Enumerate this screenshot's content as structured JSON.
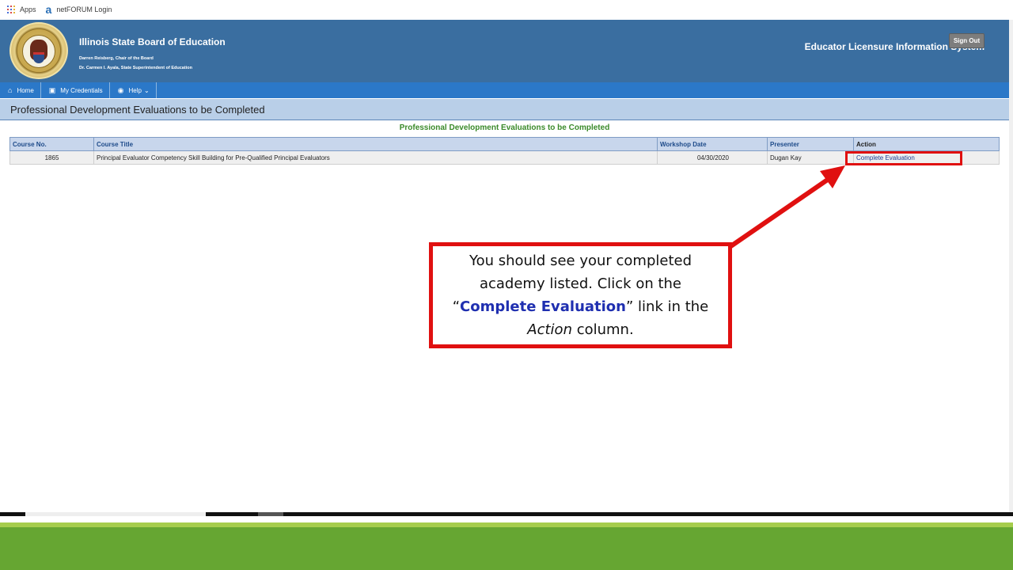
{
  "bookmarks": {
    "apps_label": "Apps",
    "netforum_label": "netFORUM Login"
  },
  "header": {
    "org_name": "Illinois State Board of Education",
    "chair_line": "Darren Reisberg, Chair of the Board",
    "superintendent_line": "Dr. Carmen I. Ayala, State Superintendent of Education",
    "system_name": "Educator Licensure Information System",
    "sign_out_label": "Sign Out"
  },
  "nav": {
    "items": [
      {
        "label": "Home",
        "icon": "home-icon"
      },
      {
        "label": "My Credentials",
        "icon": "credentials-icon"
      },
      {
        "label": "Help",
        "icon": "help-icon"
      }
    ]
  },
  "page": {
    "title": "Professional Development Evaluations to be Completed"
  },
  "table": {
    "caption": "Professional Development Evaluations to be Completed",
    "headers": [
      "Course No.",
      "Course Title",
      "Workshop Date",
      "Presenter",
      "Action"
    ],
    "rows": [
      {
        "course_no": "1865",
        "course_title": "Principal Evaluator Competency Skill Building for Pre-Qualified Principal Evaluators",
        "workshop_date": "04/30/2020",
        "presenter": "Dugan Kay",
        "action": "Complete Evaluation"
      }
    ]
  },
  "callout": {
    "line_1": "You should see your completed academy listed. Click on the",
    "open_quote": "“",
    "emphasis": "Complete Evaluation",
    "close_quote": "”",
    "line_2": " link in the ",
    "italic": "Action",
    "line_3": " column."
  },
  "colors": {
    "header_bg": "#3a6ea0",
    "nav_bg": "#2b78c8",
    "highlight_red": "#e01010",
    "caption_green": "#3a8a2a",
    "footer_green": "#66a632"
  }
}
